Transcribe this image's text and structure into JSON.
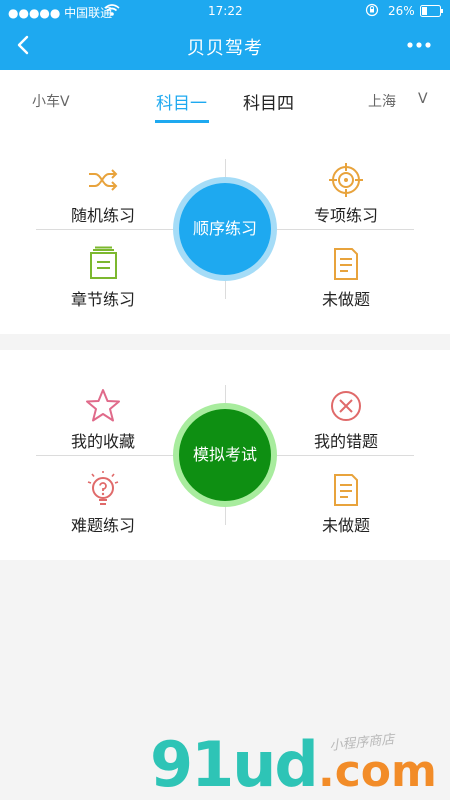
{
  "status_bar": {
    "carrier": "●●●●● 中国联通",
    "time": "17:22",
    "battery": "26%"
  },
  "nav": {
    "title": "贝贝驾考"
  },
  "subject_bar": {
    "car": "小车V",
    "tab1": "科目一",
    "tab2": "科目四",
    "city": "上海",
    "city_chevron": "V"
  },
  "practice": {
    "center": "顺序练习",
    "top_left": "随机练习",
    "top_right": "专项练习",
    "bottom_left": "章节练习",
    "bottom_right": "未做题"
  },
  "exam": {
    "center": "模拟考试",
    "top_left": "我的收藏",
    "top_right": "我的错题",
    "bottom_left": "难题练习",
    "bottom_right": "未做题"
  },
  "watermark": {
    "text": "91ud.com",
    "tagline": "小程序商店"
  },
  "colors": {
    "primary": "#1ea9f0",
    "accent_orange": "#e8a33c",
    "accent_green": "#7cb82f",
    "accent_red": "#e06a6a",
    "exam_green": "#0e8f12"
  }
}
